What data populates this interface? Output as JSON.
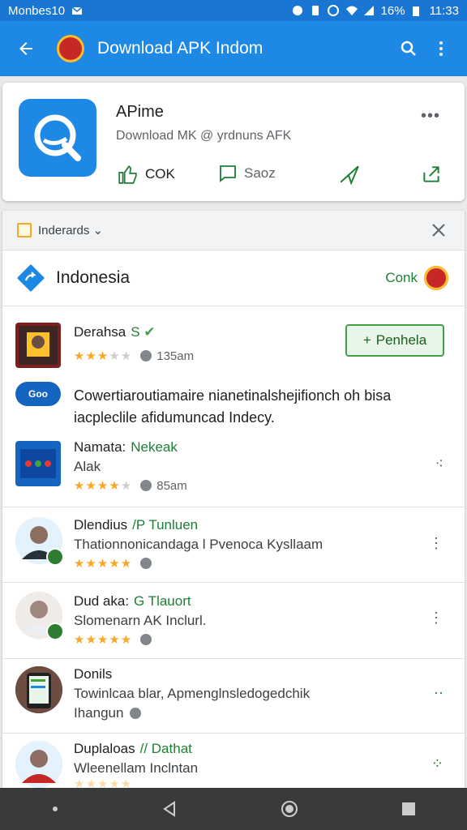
{
  "status": {
    "carrier": "Monbes10",
    "battery": "16%",
    "time": "11:33"
  },
  "appbar": {
    "title": "Download APK Indom"
  },
  "app": {
    "name": "APime",
    "subtitle": "Download MK @ yrdnuns AFK",
    "actions": [
      {
        "label": "COK"
      },
      {
        "label": "Saoz"
      },
      {
        "label": ""
      },
      {
        "label": ""
      }
    ]
  },
  "filter": {
    "label": "Inderards"
  },
  "country": {
    "name": "Indonesia",
    "link": "Conk"
  },
  "items": [
    {
      "title": "Derahsa",
      "tag": "S",
      "rating": 3.5,
      "meta": "135am",
      "button": "Penhela"
    },
    {
      "promo": "Cowertiaroutiamaire nianetinalshejifionch oh bisa iacpleclile afidumuncad Indecy."
    },
    {
      "title": "Namata:",
      "tag": "Nekeak",
      "subtitle": "Alak",
      "rating": 4,
      "meta": "85am"
    },
    {
      "title": "Dlendius",
      "tag": "/P Tunluen",
      "subtitle": "Thationnonicandaga l Pvenoca Kysllaam",
      "rating": 4.5
    },
    {
      "title": "Dud aka:",
      "tag": "G Tlauort",
      "subtitle": "Slomenarn AK Inclurl.",
      "rating": 4.5
    },
    {
      "title": "Donils",
      "subtitle": "Towinlcaa blar, Apmenglnsledogedchik",
      "subtitle2": "Ihangun"
    },
    {
      "title": "Duplaloas",
      "tag": "// Dathat",
      "subtitle": "Wleenellam Inclntan"
    }
  ],
  "colors": {
    "primary": "#1e88e5",
    "accent_green": "#1e7e34",
    "star": "#f9a825"
  }
}
